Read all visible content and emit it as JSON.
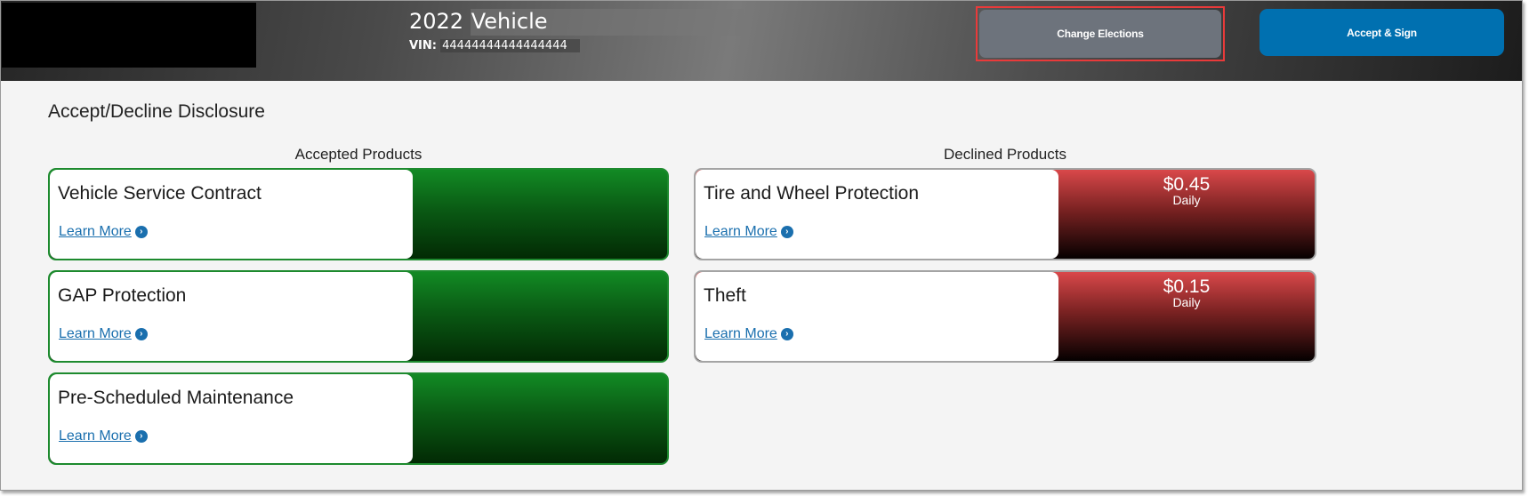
{
  "header": {
    "vehicle_title": {
      "year": "2022",
      "model": "Vehicle"
    },
    "vin_label": "VIN:",
    "vin_value": "44444444444444444",
    "buttons": {
      "change_elections": "Change Elections",
      "accept_sign": "Accept & Sign"
    }
  },
  "main": {
    "title": "Accept/Decline Disclosure",
    "accepted": {
      "heading": "Accepted Products",
      "items": [
        {
          "name": "Vehicle Service Contract",
          "link": "Learn More"
        },
        {
          "name": "GAP Protection",
          "link": "Learn More"
        },
        {
          "name": "Pre-Scheduled Maintenance",
          "link": "Learn More"
        }
      ]
    },
    "declined": {
      "heading": "Declined Products",
      "items": [
        {
          "name": "Tire and Wheel Protection",
          "link": "Learn More",
          "price": "$0.45",
          "period": "Daily"
        },
        {
          "name": "Theft",
          "link": "Learn More",
          "price": "$0.15",
          "period": "Daily"
        }
      ]
    }
  },
  "icons": {
    "learn_more_chevron": "›"
  },
  "colors": {
    "accepted_green": "#1d8a2e",
    "declined_red": "#d9484a",
    "accept_button_blue": "#0070b0",
    "change_button_grey": "#6d737c",
    "link_blue": "#1a6fae",
    "highlight_red": "#e93a3a"
  }
}
